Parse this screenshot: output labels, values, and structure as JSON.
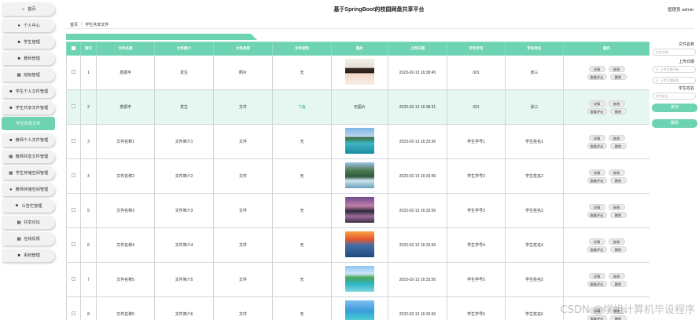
{
  "app": {
    "title": "基于SpringBoot的校园网盘共享平台",
    "user_label": "管理员 admin"
  },
  "breadcrumb": {
    "home": "首页",
    "separator": "/",
    "current": "学生共享文件"
  },
  "sidebar": {
    "items": [
      {
        "label": "首页",
        "icon": "home-icon",
        "glyph": "⌂"
      },
      {
        "label": "个人中心",
        "icon": "user-icon",
        "glyph": "●"
      },
      {
        "label": "学生管理",
        "icon": "student-icon",
        "glyph": "■"
      },
      {
        "label": "教师管理",
        "icon": "teacher-icon",
        "glyph": "■"
      },
      {
        "label": "班级管理",
        "icon": "grid-icon",
        "glyph": "▦"
      },
      {
        "label": "学生个人文件管理",
        "icon": "file-icon",
        "glyph": "■"
      },
      {
        "label": "学生共享文件管理",
        "icon": "share-icon",
        "glyph": "■"
      },
      {
        "label": "学生共享文件",
        "icon": "",
        "glyph": ""
      },
      {
        "label": "教师个人文件管理",
        "icon": "file-icon",
        "glyph": "■"
      },
      {
        "label": "教师共享文件管理",
        "icon": "grid-icon",
        "glyph": "▦"
      },
      {
        "label": "学生存储空间管理",
        "icon": "grid-icon",
        "glyph": "▦"
      },
      {
        "label": "教师存储空间管理",
        "icon": "location-icon",
        "glyph": "●"
      },
      {
        "label": "公告栏管理",
        "icon": "flag-icon",
        "glyph": "⚑"
      },
      {
        "label": "共享论坛",
        "icon": "grid-icon",
        "glyph": "▦"
      },
      {
        "label": "在线反馈",
        "icon": "grid-icon",
        "glyph": "▦"
      },
      {
        "label": "系统管理",
        "icon": "settings-icon",
        "glyph": "■"
      }
    ]
  },
  "table": {
    "headers": [
      "索引",
      "文件名称",
      "文件简介",
      "文件类型",
      "文件资料",
      "图片",
      "上传日期",
      "学生学号",
      "学生姓名",
      "操作"
    ],
    "actions": {
      "detail": "详情",
      "edit": "修改",
      "comments": "查看评论",
      "delete": "删除"
    },
    "rows": [
      {
        "index": "1",
        "name": "发顺丰",
        "intro": "发生",
        "type": "照片",
        "material": "无",
        "image": "portrait",
        "date": "2023-02-13 16:38:45",
        "sno": "001",
        "sname": "张三"
      },
      {
        "index": "2",
        "name": "发顺丰",
        "intro": "发生",
        "type": "文件",
        "material": "下载",
        "image_text": "无图片",
        "date": "2023-02-13 16:38:31",
        "sno": "001",
        "sname": "张三"
      },
      {
        "index": "3",
        "name": "文件名称1",
        "intro": "文件简介1",
        "type": "文件",
        "material": "无",
        "image": "lake",
        "date": "2023-02-13 16:33:56",
        "sno": "学生学号1",
        "sname": "学生姓名1"
      },
      {
        "index": "4",
        "name": "文件名称2",
        "intro": "文件简介2",
        "type": "文件",
        "material": "无",
        "image": "waterfall",
        "date": "2023-02-13 16:33:56",
        "sno": "学生学号2",
        "sname": "学生姓名2"
      },
      {
        "index": "5",
        "name": "文件名称3",
        "intro": "文件简介3",
        "type": "文件",
        "material": "无",
        "image": "dusk",
        "date": "2023-02-13 16:33:56",
        "sno": "学生学号3",
        "sname": "学生姓名3"
      },
      {
        "index": "6",
        "name": "文件名称4",
        "intro": "文件简介4",
        "type": "文件",
        "material": "无",
        "image": "sunset",
        "date": "2023-02-13 16:33:56",
        "sno": "学生学号4",
        "sname": "学生姓名4"
      },
      {
        "index": "7",
        "name": "文件名称5",
        "intro": "文件简介5",
        "type": "文件",
        "material": "无",
        "image": "beach",
        "date": "2023-02-13 16:33:56",
        "sno": "学生学号5",
        "sname": "学生姓名5"
      },
      {
        "index": "8",
        "name": "文件名称6",
        "intro": "文件简介6",
        "type": "文件",
        "material": "无",
        "image": "tropical",
        "date": "2023-02-13 16:33:56",
        "sno": "学生学号6",
        "sname": "学生姓名6"
      }
    ]
  },
  "search": {
    "name_label": "文件名称",
    "name_placeholder": "文件名称",
    "date_label": "上传日期",
    "date_start_placeholder": "上传日期开始",
    "date_end_placeholder": "上传日期结束",
    "student_label": "学生姓名",
    "student_placeholder": "学生姓名",
    "search_button": "查询",
    "delete_button": "删除"
  },
  "watermark": "CSDN @学姐计算机毕设程序",
  "colors": {
    "accent": "#6ed3b3",
    "highlight_row": "#e6f7f1"
  }
}
